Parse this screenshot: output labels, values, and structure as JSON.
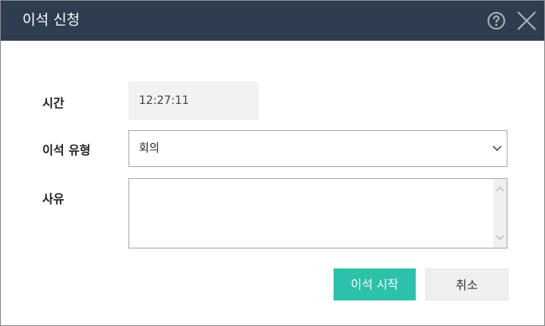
{
  "dialog": {
    "title": "이석 신청"
  },
  "form": {
    "time_label": "시간",
    "time_value": "12:27:11",
    "type_label": "이석 유형",
    "type_selected": "회의",
    "reason_label": "사유",
    "reason_value": ""
  },
  "buttons": {
    "start_label": "이석 시작",
    "cancel_label": "취소"
  },
  "icons": {
    "help": "help-icon",
    "close": "close-icon",
    "dropdown": "chevron-down-icon"
  },
  "colors": {
    "titlebar": "#2e3d50",
    "accent": "#2cc2a9"
  }
}
